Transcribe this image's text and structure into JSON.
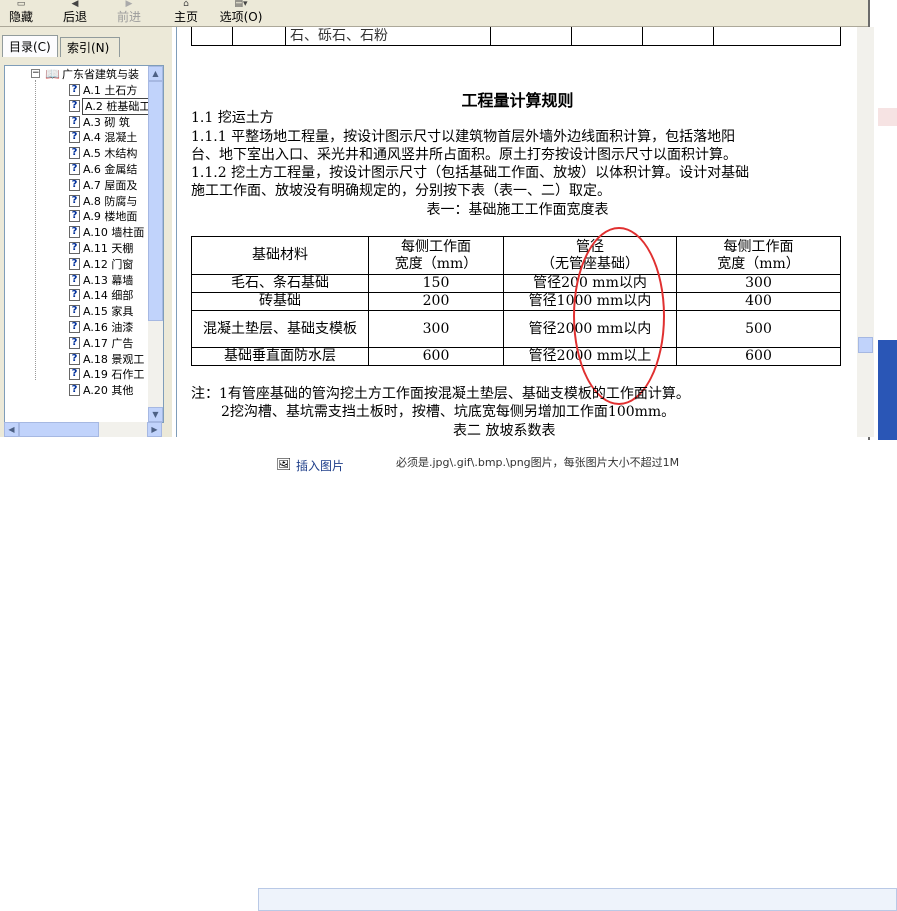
{
  "toolbar": {
    "buttons": [
      {
        "label": "隐藏",
        "icon": "hide-icon",
        "enabled": true
      },
      {
        "label": "后退",
        "icon": "back-icon",
        "enabled": true
      },
      {
        "label": "前进",
        "icon": "forward-icon",
        "enabled": false
      },
      {
        "label": "主页",
        "icon": "home-icon",
        "enabled": true
      },
      {
        "label": "选项(O)",
        "icon": "options-icon",
        "enabled": true
      }
    ]
  },
  "nav": {
    "tabs": [
      "目录(C)",
      "索引(N)"
    ],
    "tree": {
      "root": "广东省建筑与装",
      "items": [
        {
          "code": "A.1",
          "name": "土石方"
        },
        {
          "code": "A.2",
          "name": "桩基础工程"
        },
        {
          "code": "A.3",
          "name": "砌  筑"
        },
        {
          "code": "A.4",
          "name": "混凝土"
        },
        {
          "code": "A.5",
          "name": "木结构"
        },
        {
          "code": "A.6",
          "name": "金属结"
        },
        {
          "code": "A.7",
          "name": "屋面及"
        },
        {
          "code": "A.8",
          "name": "防腐与"
        },
        {
          "code": "A.9",
          "name": "楼地面"
        },
        {
          "code": "A.10",
          "name": "墙柱面"
        },
        {
          "code": "A.11",
          "name": "天棚"
        },
        {
          "code": "A.12",
          "name": "门窗"
        },
        {
          "code": "A.13",
          "name": "幕墙"
        },
        {
          "code": "A.14",
          "name": "细部"
        },
        {
          "code": "A.15",
          "name": "家具"
        },
        {
          "code": "A.16",
          "name": "油漆"
        },
        {
          "code": "A.17",
          "name": "广告"
        },
        {
          "code": "A.18",
          "name": "景观工"
        },
        {
          "code": "A.19",
          "name": "石作工"
        },
        {
          "code": "A.20",
          "name": "其他"
        }
      ]
    }
  },
  "document": {
    "top_table_fragment": "石、砾石、石粉",
    "title": "工程量计算规则",
    "paragraphs": [
      "1.1  挖运土方",
      "1.1.1  平整场地工程量，按设计图示尺寸以建筑物首层外墙外边线面积计算，包括落地阳",
      "台、地下室出入口、采光井和通风竖井所占面积。原土打夯按设计图示尺寸以面积计算。",
      "1.1.2  挖土方工程量，按设计图示尺寸（包括基础工作面、放坡）以体积计算。设计对基础",
      "施工工作面、放坡没有明确规定的，分别按下表（表一、二）取定。"
    ],
    "table_caption": "表一：基础施工工作面宽度表",
    "table": {
      "headers": [
        [
          "基础材料"
        ],
        [
          "每侧工作面",
          "宽度（mm）"
        ],
        [
          "管径",
          "（无管座基础）"
        ],
        [
          "每侧工作面",
          "宽度（mm）"
        ]
      ],
      "rows": [
        [
          "毛石、条石基础",
          "150",
          "管径200 mm以内",
          "300"
        ],
        [
          "砖基础",
          "200",
          "管径1000 mm以内",
          "400"
        ],
        [
          "混凝土垫层、基础支模板",
          "300",
          "管径2000 mm以内",
          "500"
        ],
        [
          "基础垂直面防水层",
          "600",
          "管径2000 mm以上",
          "600"
        ]
      ]
    },
    "notes": [
      "注：1有管座基础的管沟挖土方工作面按混凝土垫层、基础支模板的工作面计算。",
      "    2挖沟槽、基坑需支挡土板时，按槽、坑底宽每侧另增加工作面100mm。"
    ],
    "next_caption_fragment": "表二  放坡系数表"
  },
  "bottom": {
    "insert_image_label": "插入图片",
    "hint": "必须是.jpg\\.gif\\.bmp.\\png图片，每张图片大小不超过1M"
  }
}
